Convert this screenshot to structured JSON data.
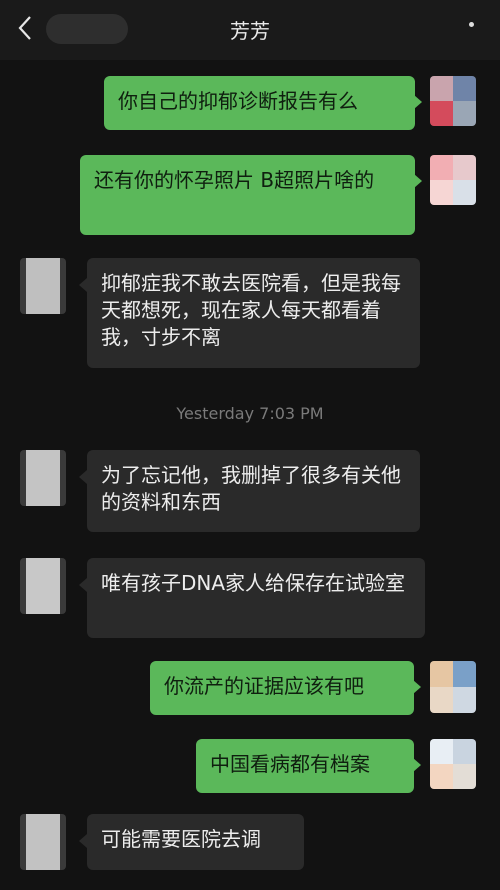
{
  "header": {
    "title": "芳芳",
    "back_icon": "chevron-left-icon",
    "more_icon": "more-dots-icon"
  },
  "timestamp": "Yesterday 7:03 PM",
  "messages": [
    {
      "from": "me",
      "text": "你自己的抑郁诊断报告有么"
    },
    {
      "from": "me",
      "text": "还有你的怀孕照片 B超照片啥的"
    },
    {
      "from": "them",
      "text": "抑郁症我不敢去医院看，但是我每天都想死，现在家人每天都看着我，寸步不离"
    },
    {
      "from": "them",
      "text": "为了忘记他，我删掉了很多有关他的资料和东西"
    },
    {
      "from": "them",
      "text": "唯有孩子DNA家人给保存在试验室"
    },
    {
      "from": "me",
      "text": "你流产的证据应该有吧"
    },
    {
      "from": "me",
      "text": "中国看病都有档案"
    },
    {
      "from": "them",
      "text": "可能需要医院去调"
    }
  ],
  "colors": {
    "background": "#121212",
    "my_bubble": "#5bb85a",
    "their_bubble": "#2a2a2a"
  }
}
